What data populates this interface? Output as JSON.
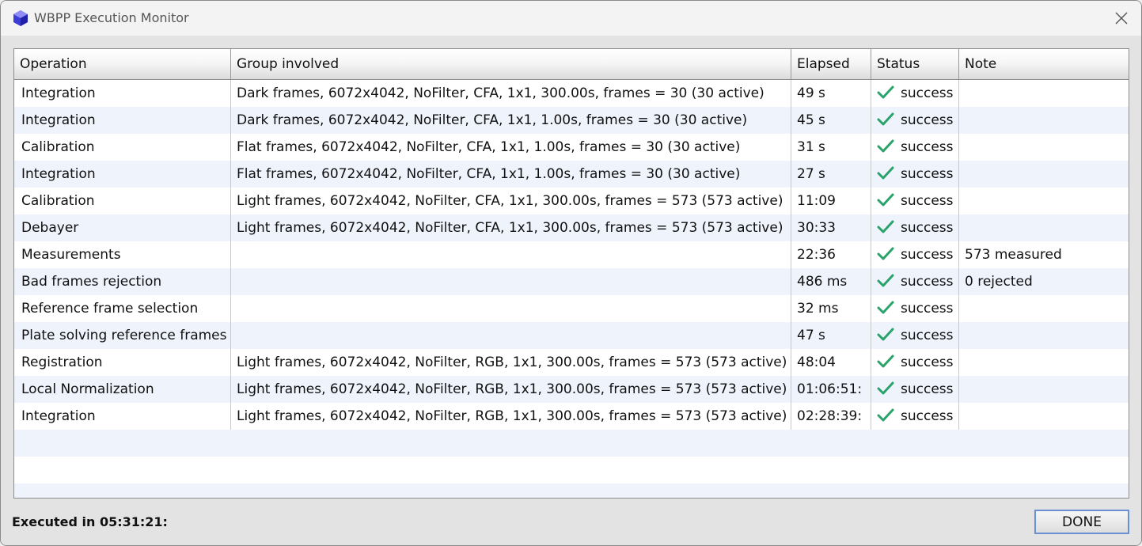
{
  "window": {
    "title": "WBPP Execution Monitor"
  },
  "table": {
    "headers": [
      "Operation",
      "Group involved",
      "Elapsed",
      "Status",
      "Note"
    ],
    "rows": [
      {
        "operation": "Integration",
        "group": "Dark frames, 6072x4042, NoFilter, CFA, 1x1, 300.00s, frames = 30 (30 active)",
        "elapsed": "49 s",
        "status": "success",
        "note": ""
      },
      {
        "operation": "Integration",
        "group": "Dark frames, 6072x4042, NoFilter, CFA, 1x1, 1.00s, frames = 30 (30 active)",
        "elapsed": "45 s",
        "status": "success",
        "note": ""
      },
      {
        "operation": "Calibration",
        "group": "Flat frames, 6072x4042, NoFilter, CFA, 1x1, 1.00s, frames = 30 (30 active)",
        "elapsed": "31 s",
        "status": "success",
        "note": ""
      },
      {
        "operation": "Integration",
        "group": "Flat frames, 6072x4042, NoFilter, CFA, 1x1, 1.00s, frames = 30 (30 active)",
        "elapsed": "27 s",
        "status": "success",
        "note": ""
      },
      {
        "operation": "Calibration",
        "group": "Light frames, 6072x4042, NoFilter, CFA, 1x1, 300.00s, frames = 573 (573 active)",
        "elapsed": "11:09",
        "status": "success",
        "note": ""
      },
      {
        "operation": "Debayer",
        "group": "Light frames, 6072x4042, NoFilter, CFA, 1x1, 300.00s, frames = 573 (573 active)",
        "elapsed": "30:33",
        "status": "success",
        "note": ""
      },
      {
        "operation": "Measurements",
        "group": "",
        "elapsed": "22:36",
        "status": "success",
        "note": "573 measured"
      },
      {
        "operation": "Bad frames rejection",
        "group": "",
        "elapsed": "486 ms",
        "status": "success",
        "note": "0 rejected"
      },
      {
        "operation": "Reference frame selection",
        "group": "",
        "elapsed": "32 ms",
        "status": "success",
        "note": ""
      },
      {
        "operation": "Plate solving reference frames",
        "group": "",
        "elapsed": "47 s",
        "status": "success",
        "note": ""
      },
      {
        "operation": "Registration",
        "group": "Light frames, 6072x4042, NoFilter, RGB, 1x1, 300.00s, frames = 573 (573 active)",
        "elapsed": "48:04",
        "status": "success",
        "note": ""
      },
      {
        "operation": "Local Normalization",
        "group": "Light frames, 6072x4042, NoFilter, RGB, 1x1, 300.00s, frames = 573 (573 active)",
        "elapsed": "01:06:51:",
        "status": "success",
        "note": ""
      },
      {
        "operation": "Integration",
        "group": "Light frames, 6072x4042, NoFilter, RGB, 1x1, 300.00s, frames = 573 (573 active)",
        "elapsed": "02:28:39:",
        "status": "success",
        "note": ""
      }
    ],
    "empty_rows": 3
  },
  "footer": {
    "executed_label": "Executed in 05:31:21:",
    "done_label": "DONE"
  },
  "colors": {
    "success_check": "#2aa36b",
    "row_alt": "#eef3fc",
    "button_border": "#6a8fd4"
  },
  "icons": {
    "app": "wbpp-app-icon",
    "close": "close-icon",
    "status": "checkmark-icon"
  }
}
